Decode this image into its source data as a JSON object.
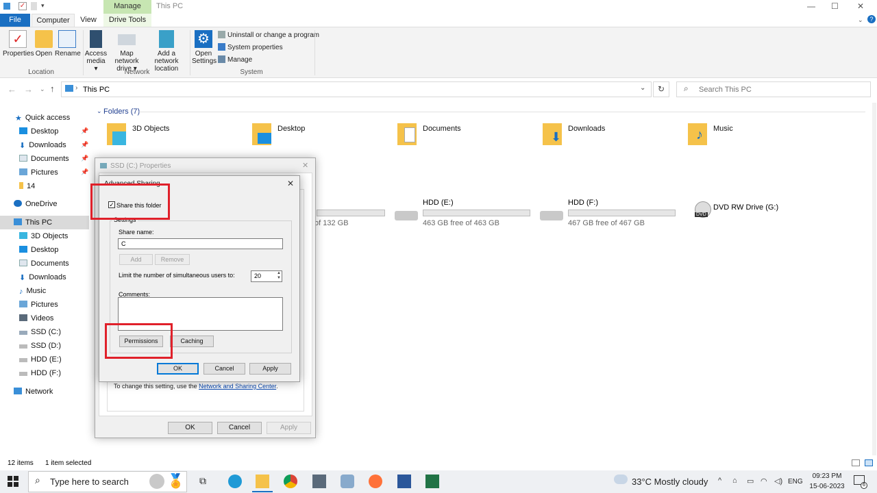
{
  "window": {
    "title": "This PC",
    "manage_tab": "Manage",
    "minimize": "—",
    "maximize": "☐",
    "close": "✕"
  },
  "ribbon_tabs": [
    "File",
    "Computer",
    "View",
    "Drive Tools"
  ],
  "ribbon": {
    "location": {
      "properties": "Properties",
      "open": "Open",
      "rename": "Rename",
      "group": "Location"
    },
    "network": {
      "access_media": "Access media ▾",
      "map_drive": "Map network drive ▾",
      "add_location": "Add a network location",
      "group": "Network"
    },
    "system": {
      "open_settings": "Open Settings",
      "uninstall": "Uninstall or change a program",
      "sys_props": "System properties",
      "manage": "Manage",
      "group": "System"
    }
  },
  "address": {
    "path": "This PC",
    "search_placeholder": "Search This PC"
  },
  "nav": {
    "quick_access": "Quick access",
    "qa_items": [
      "Desktop",
      "Downloads",
      "Documents",
      "Pictures",
      "14"
    ],
    "onedrive": "OneDrive",
    "this_pc": "This PC",
    "pc_items": [
      "3D Objects",
      "Desktop",
      "Documents",
      "Downloads",
      "Music",
      "Pictures",
      "Videos",
      "SSD (C:)",
      "SSD (D:)",
      "HDD (E:)",
      "HDD (F:)"
    ],
    "network": "Network"
  },
  "content": {
    "folders_header": "Folders (7)",
    "folders": [
      "3D Objects",
      "Desktop",
      "Documents",
      "Downloads",
      "Music"
    ],
    "drives": [
      {
        "name": "",
        "space": "of 132 GB",
        "used_fraction": 0.0
      },
      {
        "name": "HDD (E:)",
        "space": "463 GB free of 463 GB",
        "used_fraction": 0.0
      },
      {
        "name": "HDD (F:)",
        "space": "467 GB free of 467 GB",
        "used_fraction": 0.0
      },
      {
        "name": "DVD RW Drive (G:)",
        "space": ""
      }
    ]
  },
  "props_dialog": {
    "title": "SSD (C:) Properties",
    "hint": "To change this setting, use the",
    "link": "Network and Sharing Center",
    "ok": "OK",
    "cancel": "Cancel",
    "apply": "Apply"
  },
  "adv_dialog": {
    "title": "Advanced Sharing",
    "share_checkbox": "Share this folder",
    "settings_legend": "Settings",
    "share_name_label": "Share name:",
    "share_name_value": "C",
    "add": "Add",
    "remove": "Remove",
    "limit_label": "Limit the number of simultaneous users to:",
    "limit_value": "20",
    "comments_label": "Comments:",
    "permissions": "Permissions",
    "caching": "Caching",
    "ok": "OK",
    "cancel": "Cancel",
    "apply": "Apply"
  },
  "status": {
    "items": "12 items",
    "selected": "1 item selected"
  },
  "taskbar": {
    "search_placeholder": "Type here to search",
    "weather": "33°C  Mostly cloudy",
    "lang": "ENG",
    "time": "09:23 PM",
    "date": "15-06-2023",
    "notif_count": "6"
  },
  "colors": {
    "accent": "#1a6fc2",
    "highlight": "#e0202a",
    "manage_tab": "#c7e6b2"
  }
}
